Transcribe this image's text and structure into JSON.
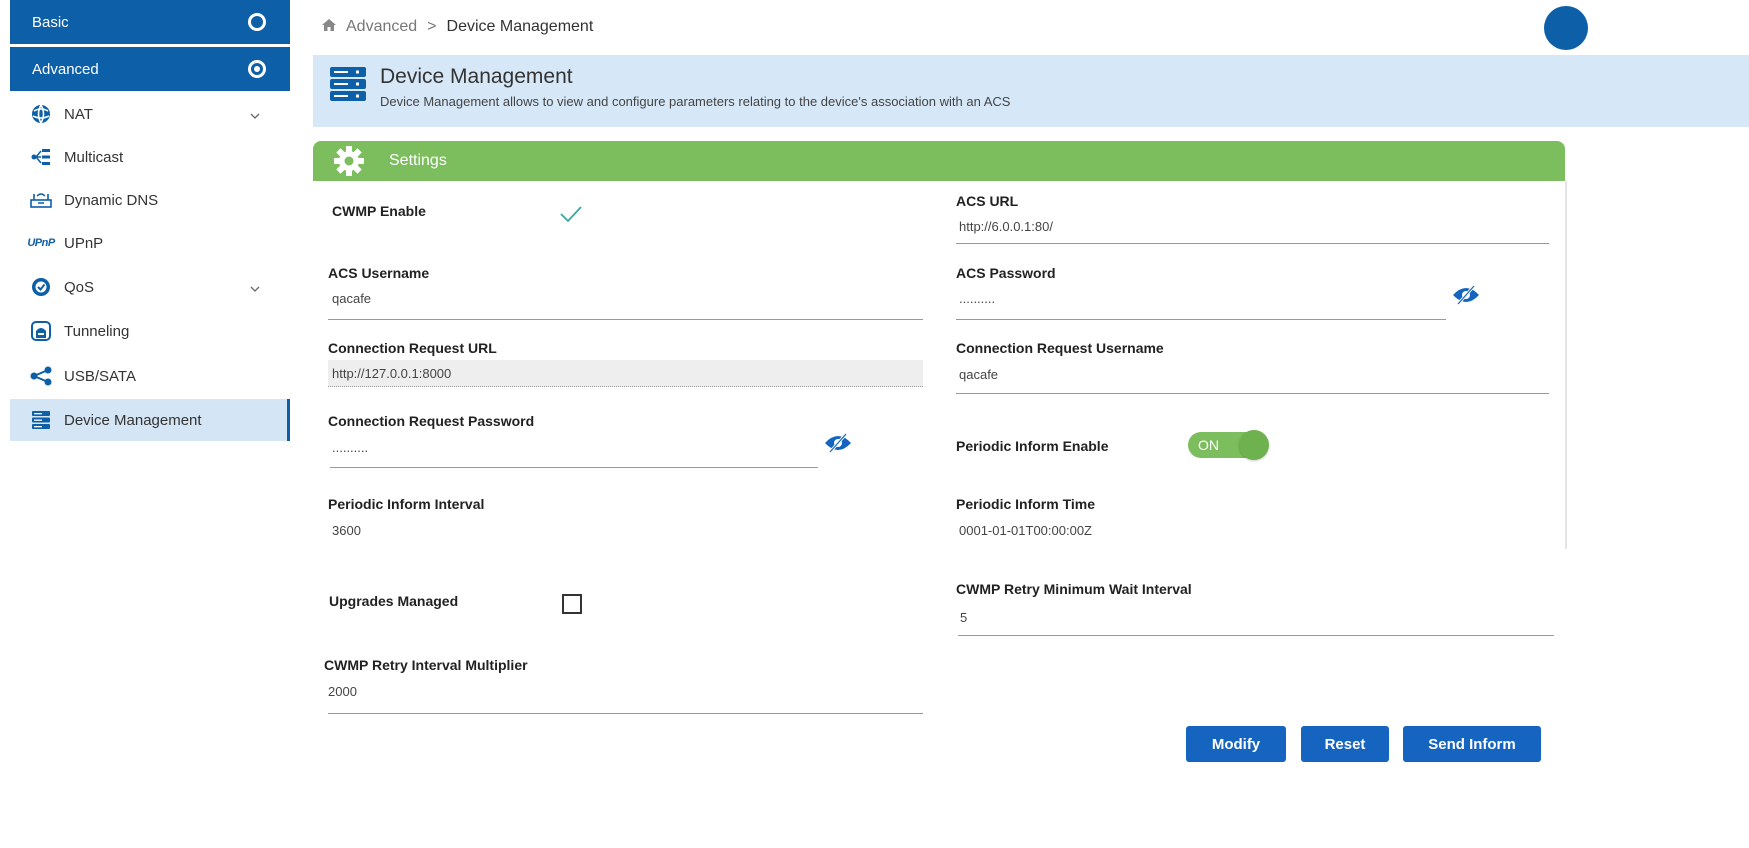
{
  "sidebar": {
    "basic_label": "Basic",
    "advanced_label": "Advanced",
    "items": [
      {
        "label": "NAT",
        "icon": "globe-icon",
        "expandable": true
      },
      {
        "label": "Multicast",
        "icon": "multicast-icon",
        "expandable": false
      },
      {
        "label": "Dynamic DNS",
        "icon": "ddns-icon",
        "expandable": false
      },
      {
        "label": "UPnP",
        "icon": "upnp-icon",
        "expandable": false
      },
      {
        "label": "QoS",
        "icon": "qos-icon",
        "expandable": true
      },
      {
        "label": "Tunneling",
        "icon": "tunnel-icon",
        "expandable": false
      },
      {
        "label": "USB/SATA",
        "icon": "share-icon",
        "expandable": false
      },
      {
        "label": "Device Management",
        "icon": "server-icon",
        "expandable": false,
        "active": true
      }
    ],
    "upnp_icon_text": "UPnP"
  },
  "breadcrumb": {
    "parent": "Advanced",
    "separator": ">",
    "current": "Device Management"
  },
  "banner": {
    "title": "Device Management",
    "description": "Device Management allows to view and configure parameters relating to the device's association with an ACS"
  },
  "settings": {
    "title": "Settings",
    "cwmp_enable_label": "CWMP Enable",
    "cwmp_enable_checked": true,
    "acs_url_label": "ACS URL",
    "acs_url_value": "http://6.0.0.1:80/",
    "acs_username_label": "ACS Username",
    "acs_username_value": "qacafe",
    "acs_password_label": "ACS Password",
    "acs_password_value": "..........",
    "conn_req_url_label": "Connection Request URL",
    "conn_req_url_value": "http://127.0.0.1:8000",
    "conn_req_username_label": "Connection Request Username",
    "conn_req_username_value": "qacafe",
    "conn_req_password_label": "Connection Request Password",
    "conn_req_password_value": "..........",
    "periodic_inform_enable_label": "Periodic Inform Enable",
    "periodic_inform_enable_state": "ON",
    "periodic_inform_interval_label": "Periodic Inform Interval",
    "periodic_inform_interval_value": "3600",
    "periodic_inform_time_label": "Periodic Inform Time",
    "periodic_inform_time_value": "0001-01-01T00:00:00Z",
    "upgrades_managed_label": "Upgrades Managed",
    "upgrades_managed_checked": false,
    "retry_min_wait_label": "CWMP Retry Minimum Wait Interval",
    "retry_min_wait_value": "5",
    "retry_multiplier_label": "CWMP Retry Interval Multiplier",
    "retry_multiplier_value": "2000"
  },
  "buttons": {
    "modify": "Modify",
    "reset": "Reset",
    "send_inform": "Send Inform"
  },
  "colors": {
    "primary": "#0d5fa8",
    "button": "#1565c0",
    "success": "#7cbd5e",
    "banner_bg": "#d6e8f8"
  }
}
